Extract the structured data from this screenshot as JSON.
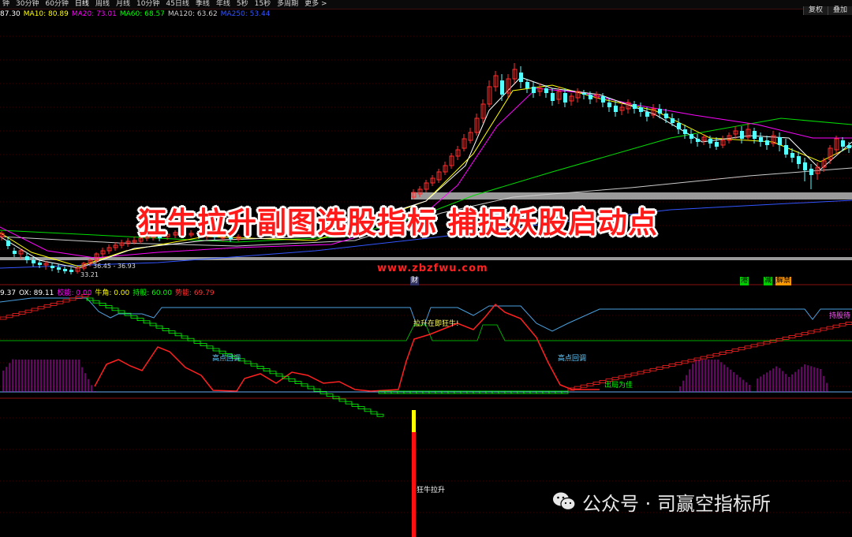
{
  "toolbar": {
    "periods": [
      "钟",
      "30分钟",
      "60分钟",
      "日线",
      "周线",
      "月线",
      "10分钟",
      "45日线",
      "季线",
      "年线",
      "5秒",
      "15秒",
      "多周期",
      "更多 >"
    ],
    "active_period": "日线",
    "right_buttons": [
      "复权",
      "叠加"
    ]
  },
  "ma_legend": [
    {
      "label": "87.30",
      "color": "#ffffff"
    },
    {
      "label": "MA10: 80.89",
      "color": "#ffff00"
    },
    {
      "label": "MA20: 73.01",
      "color": "#ff00ff"
    },
    {
      "label": "MA60: 68.57",
      "color": "#00ff00"
    },
    {
      "label": "MA120: 63.62",
      "color": "#cccccc"
    },
    {
      "label": "MA250: 53.44",
      "color": "#3355ff"
    }
  ],
  "price_labels": {
    "low": "33.21",
    "range": "36.45 - 36.93"
  },
  "overlay": {
    "title": "狂牛拉升副图选股指标 捕捉妖股启动点",
    "website": "www.zbzfwu.com"
  },
  "markers": [
    {
      "text": "财",
      "color": "#ffffff",
      "bg": "#303060"
    },
    {
      "text": "港",
      "color": "#000000",
      "bg": "#00cc00"
    },
    {
      "text": "减",
      "color": "#000000",
      "bg": "#00cc00"
    },
    {
      "text": "解禁",
      "color": "#000000",
      "bg": "#ff9900"
    }
  ],
  "indicator_legend": [
    {
      "label": "9.37",
      "color": "#ffffff"
    },
    {
      "label": "OX: 89.11",
      "color": "#ffffff"
    },
    {
      "label": "校能: 0.00",
      "color": "#ff00ff"
    },
    {
      "label": "牛角: 0.00",
      "color": "#ffff00"
    },
    {
      "label": "持股: 60.00",
      "color": "#00ff00"
    },
    {
      "label": "势能: 69.79",
      "color": "#ff3333"
    }
  ],
  "annotations": {
    "rise_strong": "拉升在即狂牛!",
    "high_pullback_1": "高点回调",
    "high_pullback_2": "高点回调",
    "exit_best": "出局为佳",
    "hold_wait": "持股待",
    "bottom_signal": "狂牛拉升"
  },
  "watermark": {
    "text": "公众号 · 司赢空指标所"
  },
  "colors": {
    "up_candle": "#ff3030",
    "down_candle": "#55ffff",
    "grid": "#3a0000"
  }
}
